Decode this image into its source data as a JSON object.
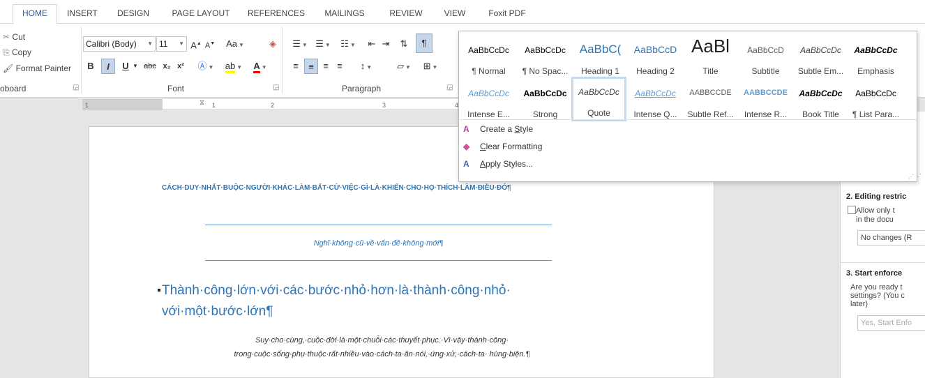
{
  "tabs": [
    "HOME",
    "INSERT",
    "DESIGN",
    "PAGE LAYOUT",
    "REFERENCES",
    "MAILINGS",
    "REVIEW",
    "VIEW",
    "Foxit PDF"
  ],
  "clipboard": {
    "cut": "Cut",
    "copy": "Copy",
    "format_painter": "Format Painter",
    "label": "oboard"
  },
  "font": {
    "name": "Calibri (Body)",
    "size": "11",
    "label": "Font",
    "grow": "A",
    "shrink": "A",
    "case": "Aa",
    "bold": "B",
    "italic": "I",
    "underline": "U",
    "strike": "abc",
    "sub": "x₂",
    "sup": "x²"
  },
  "paragraph": {
    "label": "Paragraph",
    "pilcrow": "¶"
  },
  "ruler": {
    "marks": [
      "1",
      "1",
      "2",
      "3",
      "4"
    ]
  },
  "styles": [
    {
      "sample": "AaBbCcDc",
      "name": "¶ Normal"
    },
    {
      "sample": "AaBbCcDc",
      "name": "¶ No Spac..."
    },
    {
      "sample": "AaBbC(",
      "name": "Heading 1"
    },
    {
      "sample": "AaBbCcD",
      "name": "Heading 2"
    },
    {
      "sample": "AaBl",
      "name": "Title"
    },
    {
      "sample": "AaBbCcD",
      "name": "Subtitle"
    },
    {
      "sample": "AaBbCcDc",
      "name": "Subtle Em..."
    },
    {
      "sample": "AaBbCcDc",
      "name": "Emphasis"
    },
    {
      "sample": "AaBbCcDc",
      "name": "Intense E..."
    },
    {
      "sample": "AaBbCcDc",
      "name": "Strong"
    },
    {
      "sample": "AaBbCcDc",
      "name": "Quote"
    },
    {
      "sample": "AaBbCcDc",
      "name": "Intense Q..."
    },
    {
      "sample": "AABBCCDE",
      "name": "Subtle Ref..."
    },
    {
      "sample": "AABBCCDE",
      "name": "Intense R..."
    },
    {
      "sample": "AaBbCcDc",
      "name": "Book Title"
    },
    {
      "sample": "AaBbCcDc",
      "name": "¶ List Para..."
    }
  ],
  "menu": {
    "create": [
      "Create a ",
      "S",
      "tyle"
    ],
    "clear": [
      "",
      "C",
      "lear Formatting"
    ],
    "apply": [
      "",
      "A",
      "pply Styles..."
    ]
  },
  "doc": {
    "heading": "CÁCH·DUY·NHẤT·BUỘC·NGƯỜI·KHÁC·LÀM·BẤT·CỨ·VIỆC·GÌ·LÀ·KHIẾN·CHO·HỌ·THÍCH·LÀM·ĐIỀU·ĐÓ¶",
    "subtitle": "Nghĩ·không·cũ·về·vấn·đề·không·mới¶",
    "h1": "Thành·công·lớn·với·các·bước·nhỏ·hơn·là·thành·công·nhỏ· với·một·bước·lớn¶",
    "quote": "Suy·cho·cùng,·cuộc·đời·là·một·chuỗi·các·thuyết·phục.·Vì·vậy·thành·công· trong·cuộc·sống·phụ·thuộc·rất·nhiều·vào·cách·ta·ăn·nói,·ứng·xử,·cách·ta· hùng·biện.¶"
  },
  "restrict": {
    "h2": "2. Editing restric",
    "allow1": "Allow only t",
    "allow2": "in the docu",
    "nochanges": "No changes (R",
    "h3": "3. Start enforce",
    "q1": "Are you ready t",
    "q2": "settings? (You c",
    "q3": "later)",
    "start": "Yes, Start Enfo"
  }
}
